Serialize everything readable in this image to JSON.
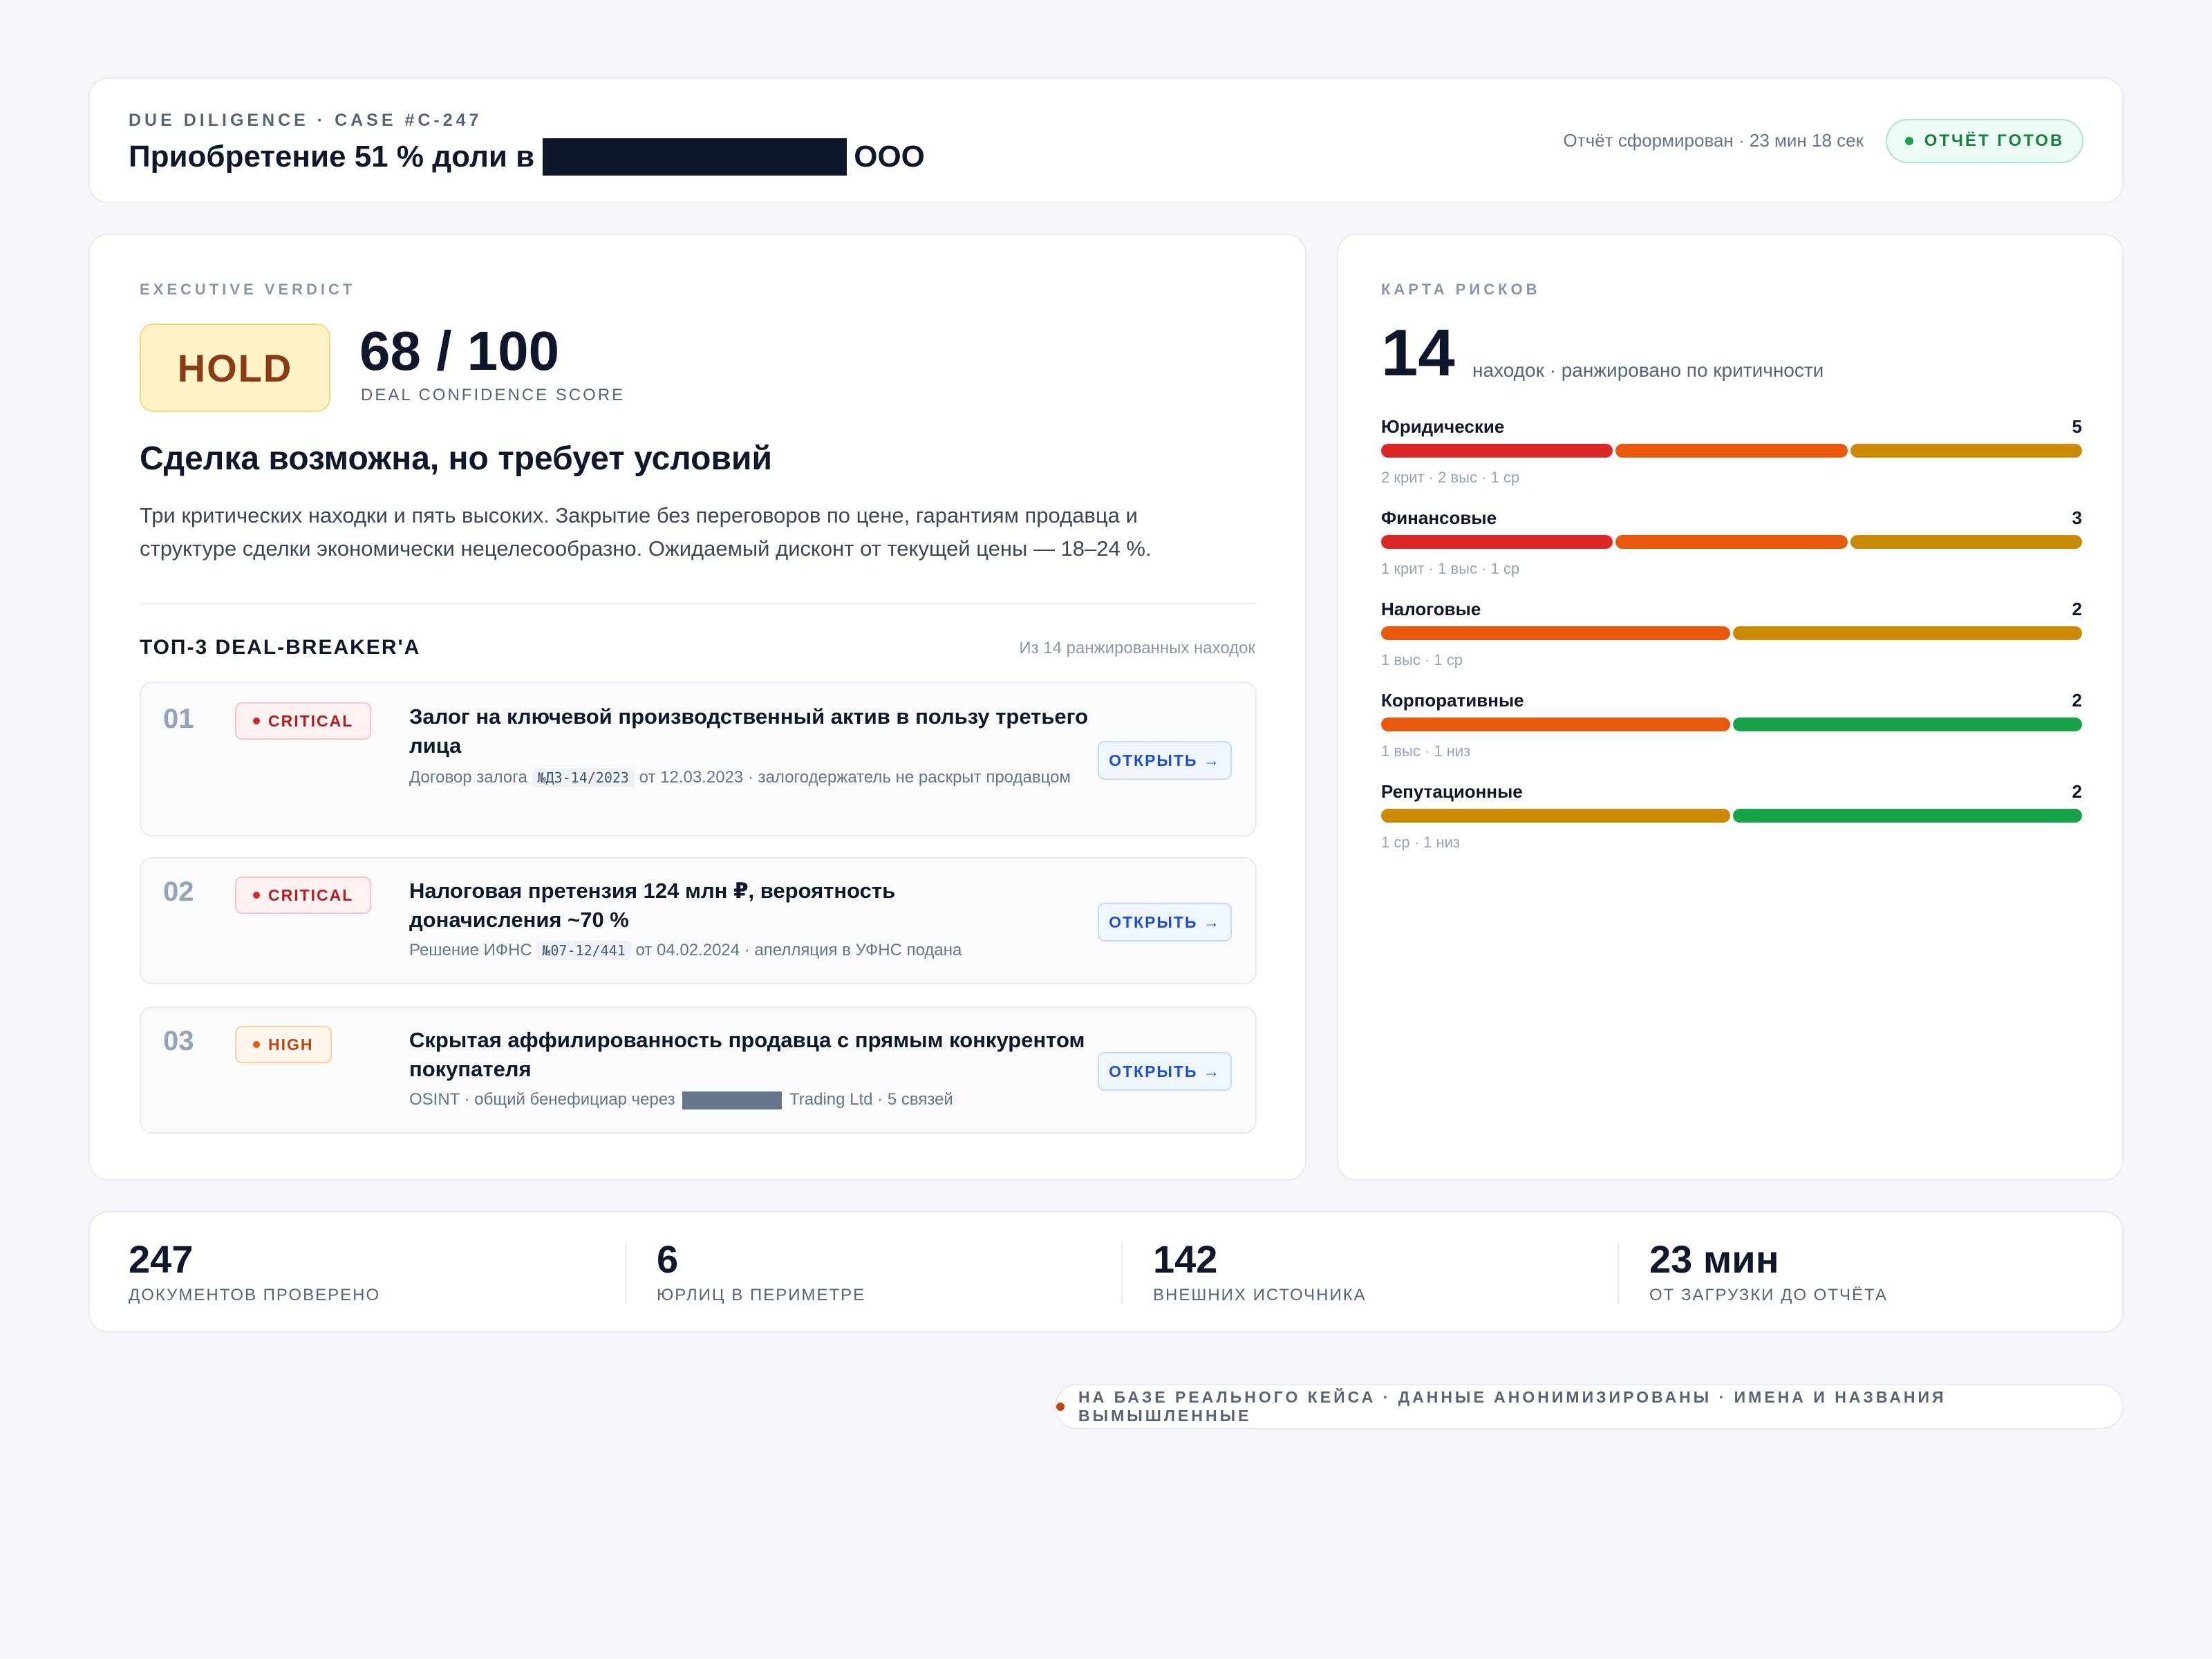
{
  "header": {
    "case_label": "DUE DILIGENCE · CASE #C-247",
    "title_prefix": "Приобретение 51 % доли в",
    "title_suffix": "ООО",
    "generated": "Отчёт сформирован · 23 мин 18 сек",
    "status": "ОТЧЁТ ГОТОВ"
  },
  "verdict": {
    "eyebrow": "EXECUTIVE VERDICT",
    "decision": "HOLD",
    "score": "68 / 100",
    "score_label": "DEAL CONFIDENCE SCORE",
    "headline": "Сделка возможна, но требует условий",
    "summary": "Три критических находки и пять высоких. Закрытие без переговоров по цене, гарантиям продавца и структуре сделки экономически нецелесообразно. Ожидаемый дисконт от текущей цены — 18–24 %.",
    "top3_title": "ТОП-3 DEAL-BREAKER'A",
    "top3_note": "Из 14 ранжированных находок",
    "open_label": "ОТКРЫТЬ →",
    "findings": [
      {
        "num": "01",
        "severity": "CRITICAL",
        "title": "Залог на ключевой производственный актив в пользу третьего лица",
        "meta_before": "Договор залога",
        "code": "№ДЗ-14/2023",
        "meta_after": "от 12.03.2023 · залогодержатель не раскрыт продавцом"
      },
      {
        "num": "02",
        "severity": "CRITICAL",
        "title": "Налоговая претензия 124 млн ₽, вероятность доначисления ~70 %",
        "meta_before": "Решение ИФНС",
        "code": "№07-12/441",
        "meta_after": "от 04.02.2024 · апелляция в УФНС подана"
      },
      {
        "num": "03",
        "severity": "HIGH",
        "title": "Скрытая аффилированность продавца с прямым конкурентом покупателя",
        "meta_before": "OSINT · общий бенефициар через",
        "meta_after": "Trading Ltd · 5 связей"
      }
    ]
  },
  "risk_map": {
    "eyebrow": "КАРТА РИСКОВ",
    "total": "14",
    "total_label": "находок · ранжировано по критичности",
    "categories": [
      {
        "name": "Юридические",
        "count": "5",
        "breakdown": "2 крит · 2 выс · 1 ср"
      },
      {
        "name": "Финансовые",
        "count": "3",
        "breakdown": "1 крит · 1 выс · 1 ср"
      },
      {
        "name": "Налоговые",
        "count": "2",
        "breakdown": "1 выс · 1 ср"
      },
      {
        "name": "Корпоративные",
        "count": "2",
        "breakdown": "1 выс · 1 низ"
      },
      {
        "name": "Репутационные",
        "count": "2",
        "breakdown": "1 ср · 1 низ"
      }
    ],
    "colors": {
      "critical": "#dc2626",
      "high": "#ea580c",
      "medium": "#ca8a04",
      "low": "#16a34a"
    }
  },
  "stats": [
    {
      "value": "247",
      "label": "ДОКУМЕНТОВ ПРОВЕРЕНО"
    },
    {
      "value": "6",
      "label": "ЮРЛИЦ В ПЕРИМЕТРЕ"
    },
    {
      "value": "142",
      "label": "ВНЕШНИХ ИСТОЧНИКА"
    },
    {
      "value": "23 мин",
      "label": "ОТ ЗАГРУЗКИ ДО ОТЧЁТА"
    }
  ],
  "disclaimer": "НА БАЗЕ РЕАЛЬНОГО КЕЙСА · ДАННЫЕ АНОНИМИЗИРОВАНЫ · ИМЕНА И НАЗВАНИЯ ВЫМЫШЛЕННЫЕ"
}
